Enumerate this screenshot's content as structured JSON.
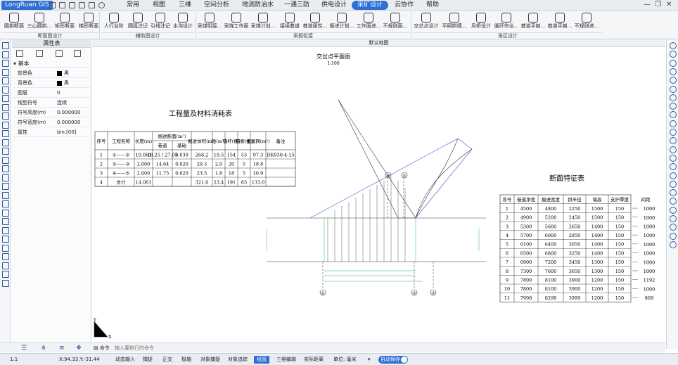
{
  "app": {
    "logo": "LongRuan GIS",
    "menus": [
      "常用",
      "视图",
      "三维",
      "空间分析",
      "地测防治水",
      "一通三防",
      "供电设计",
      "采矿设计",
      "云协作",
      "帮助"
    ],
    "active_menu": "采矿设计"
  },
  "ribbon": {
    "buttons": [
      "圆拱断面",
      "三心圆拱...",
      "矩形断面",
      "梯形断面",
      "人行台阶",
      "圆弧注记",
      "引线注记",
      "水沟设计",
      "采煤衔接...",
      "采煤工作面",
      "采煤计划...",
      "接续巷道",
      "巷道属性...",
      "掘进计划...",
      "工作面进...",
      "不规则面...",
      "交岔点设计",
      "平硐拱墙...",
      "风桥设计",
      "循环作业...",
      "巷道平剖...",
      "巷道平剖...",
      "不规则进..."
    ],
    "groups": [
      "断面图设计",
      "辅助图设计",
      "采掘衔接",
      "采区设计"
    ]
  },
  "props": {
    "title": "属性表",
    "section": "基本",
    "rows": [
      {
        "key": "前景色",
        "value": "黑"
      },
      {
        "key": "背景色",
        "value": "黑"
      },
      {
        "key": "图层",
        "value": "0"
      },
      {
        "key": "线型符号",
        "value": "连续"
      },
      {
        "key": "符号高度(m)",
        "value": "0.000000"
      },
      {
        "key": "符号宽度(m)",
        "value": "0.000000"
      },
      {
        "key": "属性",
        "value": "bin:[00]"
      }
    ]
  },
  "canvas": {
    "tab": "默认地图"
  },
  "cmd": {
    "label": "命令",
    "placeholder": "输入要执行的命令"
  },
  "status": {
    "scale": "1:1",
    "coords": "X:94.33,Y:-31.44",
    "items": [
      "动态输入",
      "捕捉",
      "正交",
      "极轴",
      "对象捕捉",
      "对象追踪",
      "线宽",
      "三维编辑",
      "实际距离"
    ],
    "active_item": "线宽",
    "unit": "单位: 毫米",
    "autosave": "自动保存"
  },
  "drawing": {
    "plan_title": "交岔点平面图",
    "plan_scale": "1:100",
    "axis_labels": [
      "①",
      "②",
      "③",
      "④",
      "⑤"
    ]
  },
  "chart_data": [
    {
      "type": "table",
      "title": "工程量及材料消耗表",
      "headers": [
        "序号",
        "工程名称",
        "长度(m)",
        "掘进断面(m²)",
        "",
        "掘进体积(m³)",
        "砼(m³)",
        "锚杆(根)",
        "锚索(根)",
        "金属网(m²)",
        "备注"
      ],
      "subheaders": [
        "巷道",
        "基础"
      ],
      "rows": [
        [
          "1",
          "①——②",
          "10.061",
          "18.25 / 27.05",
          "0.030",
          "268.2",
          "19.5",
          "154",
          "53",
          "97.3",
          "DK930-4-15"
        ],
        [
          "2",
          "②——③",
          "2.000",
          "14.64",
          "0.020",
          "29.3",
          "2.0",
          "20",
          "5",
          "18.8",
          ""
        ],
        [
          "3",
          "④——⑤",
          "2.000",
          "11.75",
          "0.020",
          "23.5",
          "1.8",
          "18",
          "5",
          "16.9",
          ""
        ],
        [
          "4",
          "合计",
          "14.061",
          "",
          "",
          "321.0",
          "23.4",
          "191",
          "63",
          "133.0",
          ""
        ]
      ]
    },
    {
      "type": "table",
      "title": "断面特征表",
      "headers": [
        "序号",
        "巷道净宽",
        "掘进宽度",
        "拱半径",
        "墙高",
        "支护厚度",
        "间距"
      ],
      "rows": [
        [
          "1",
          "4500",
          "4800",
          "2250",
          "1500",
          "150"
        ],
        [
          "2",
          "4900",
          "5200",
          "2450",
          "1500",
          "150"
        ],
        [
          "3",
          "5300",
          "5600",
          "2650",
          "1400",
          "150"
        ],
        [
          "4",
          "5700",
          "6000",
          "2850",
          "1400",
          "150"
        ],
        [
          "5",
          "6100",
          "6400",
          "3050",
          "1400",
          "150"
        ],
        [
          "6",
          "6500",
          "6800",
          "3250",
          "1400",
          "150"
        ],
        [
          "7",
          "6900",
          "7200",
          "3450",
          "1300",
          "150"
        ],
        [
          "8",
          "7300",
          "7600",
          "3650",
          "1300",
          "150"
        ],
        [
          "9",
          "7800",
          "8100",
          "3900",
          "1200",
          "150"
        ],
        [
          "10",
          "7800",
          "8100",
          "3900",
          "1200",
          "150"
        ],
        [
          "11",
          "7998",
          "8298",
          "3999",
          "1200",
          "150"
        ]
      ],
      "spacing": [
        "1000",
        "1000",
        "1000",
        "1000",
        "1000",
        "1000",
        "1000",
        "1000",
        "1192",
        "1000",
        "869"
      ]
    }
  ]
}
